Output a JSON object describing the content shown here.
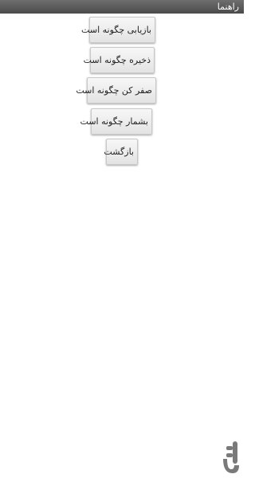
{
  "window": {
    "title": "راهنما"
  },
  "menu": {
    "buttons": [
      {
        "label": "بازیابی چگونه است"
      },
      {
        "label": "ذخیره چگونه است"
      },
      {
        "label": "صفر کن چگونه است"
      },
      {
        "label": "بشمار چگونه است"
      },
      {
        "label": "بازگشت"
      }
    ]
  },
  "branding": {
    "watermark_icon": "app-store-logo-icon",
    "color": "#7a7a7a"
  }
}
